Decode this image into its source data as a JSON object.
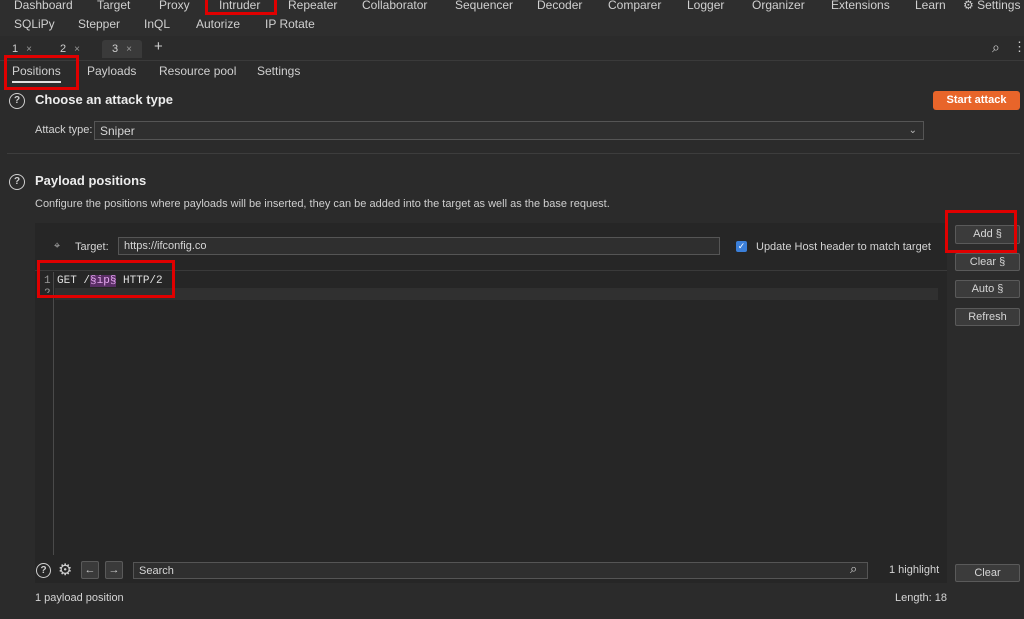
{
  "nav": {
    "row1": [
      "Dashboard",
      "Target",
      "Proxy",
      "Intruder",
      "Repeater",
      "Collaborator",
      "Sequencer",
      "Decoder",
      "Comparer",
      "Logger",
      "Organizer",
      "Extensions",
      "Learn"
    ],
    "settings_label": "Settings",
    "row2": [
      "SQLiPy",
      "Stepper",
      "InQL",
      "Autorize",
      "IP Rotate"
    ]
  },
  "tabs": [
    {
      "label": "1",
      "close": "×"
    },
    {
      "label": "2",
      "close": "×"
    },
    {
      "label": "3",
      "close": "×"
    }
  ],
  "add_tab": "+",
  "subtabs": [
    "Positions",
    "Payloads",
    "Resource pool",
    "Settings"
  ],
  "attack": {
    "heading": "Choose an attack type",
    "start_label": "Start attack",
    "type_label": "Attack type:",
    "type_value": "Sniper"
  },
  "payload_positions": {
    "heading": "Payload positions",
    "description": "Configure the positions where payloads will be inserted, they can be added into the target as well as the base request.",
    "target_label": "Target:",
    "target_value": "https://ifconfig.co",
    "update_host_label": "Update Host header to match target",
    "update_host_checked": true
  },
  "editor": {
    "line1_no": "1",
    "line2_no": "2",
    "line1_pre": "GET /",
    "line1_payload": "§ip§",
    "line1_post": " HTTP/2"
  },
  "side_buttons": {
    "add": "Add §",
    "clear": "Clear §",
    "auto": "Auto §",
    "refresh": "Refresh"
  },
  "search": {
    "placeholder": "Search",
    "highlight_count": "1 highlight",
    "clear": "Clear"
  },
  "status": {
    "positions": "1 payload position",
    "length": "Length: 18"
  },
  "colors": {
    "accent": "#e8652a",
    "highlight_box": "#e00000",
    "checkbox": "#3b7fd9"
  }
}
